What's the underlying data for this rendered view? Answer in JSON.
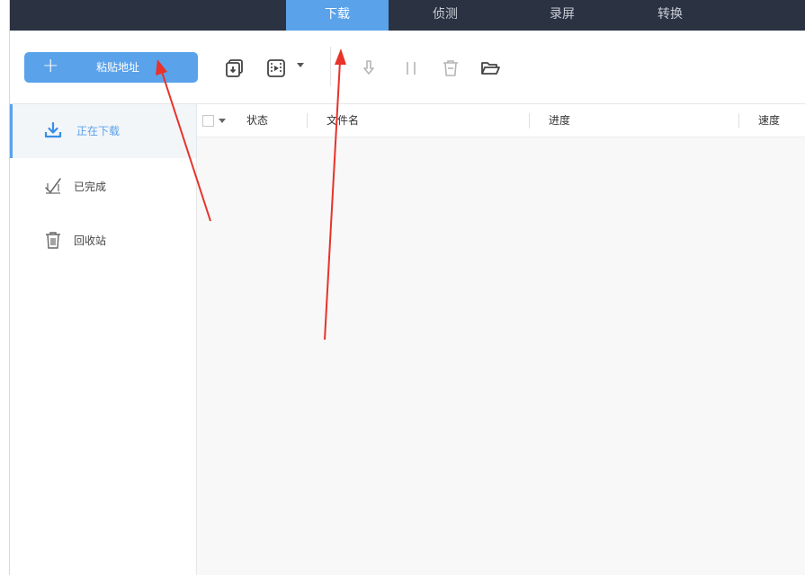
{
  "tabs": [
    {
      "label": "下载",
      "active": true
    },
    {
      "label": "侦测",
      "active": false
    },
    {
      "label": "录屏",
      "active": false
    },
    {
      "label": "转换",
      "active": false
    }
  ],
  "toolbar": {
    "paste_label": "粘贴地址",
    "icons": [
      "batch-download-icon",
      "video-download-icon",
      "start-icon",
      "pause-icon",
      "delete-icon",
      "open-folder-icon"
    ]
  },
  "sidebar": {
    "items": [
      {
        "label": "正在下载",
        "icon": "download-icon",
        "active": true
      },
      {
        "label": "已完成",
        "icon": "check-icon",
        "active": false
      },
      {
        "label": "回收站",
        "icon": "trash-icon",
        "active": false
      }
    ]
  },
  "table": {
    "columns": [
      "状态",
      "文件名",
      "进度",
      "速度"
    ],
    "rows": []
  },
  "colors": {
    "accent": "#5aa2ea",
    "topbar": "#2b3342",
    "annotation_arrow": "#e8322a"
  }
}
